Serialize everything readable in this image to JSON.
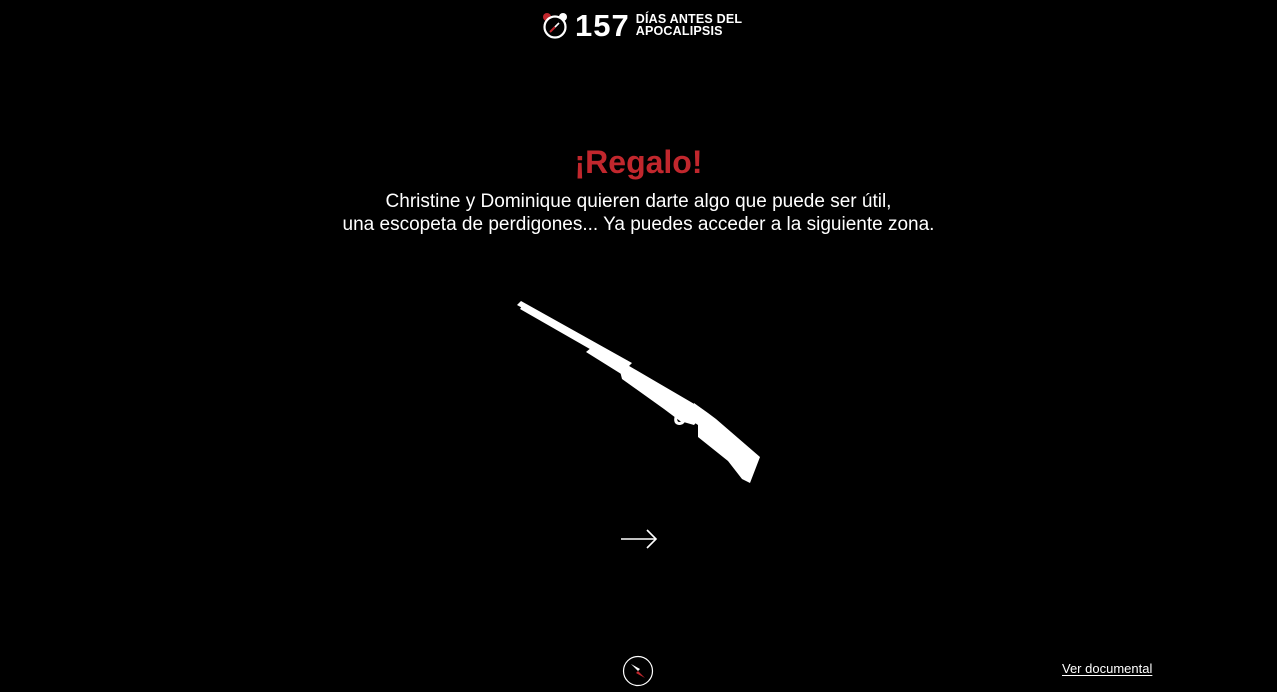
{
  "header": {
    "logo": {
      "number": "157",
      "line1": "DÍAS ANTES DEL",
      "line2": "APOCALIPSIS"
    }
  },
  "main": {
    "title": "¡Regalo!",
    "message_line1": "Christine y Dominique quieren darte algo que puede ser útil,",
    "message_line2": "una escopeta de perdigones... Ya puedes acceder a la siguiente zona.",
    "item_icon": "shotgun-icon",
    "next_icon": "arrow-right-icon"
  },
  "footer": {
    "compass_icon": "compass-icon",
    "documental_link": "Ver documental"
  },
  "colors": {
    "background": "#000000",
    "accent": "#c1272d",
    "text": "#ffffff"
  }
}
